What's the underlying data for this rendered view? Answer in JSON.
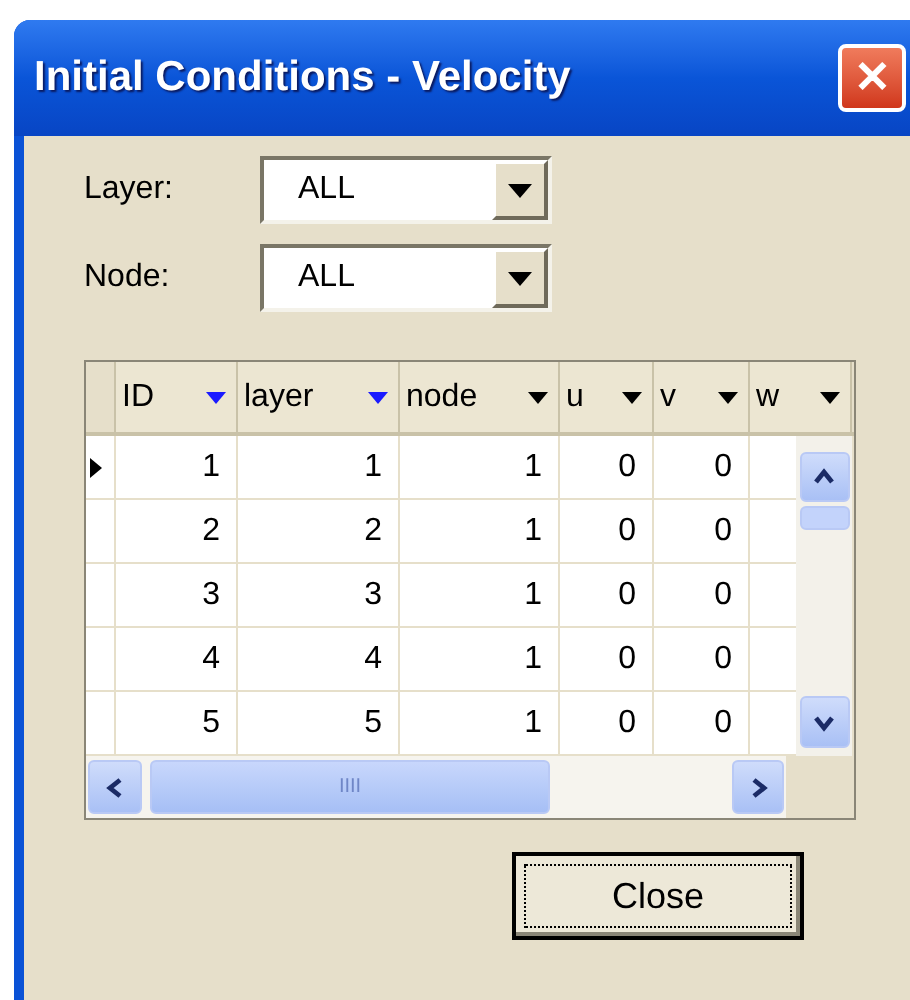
{
  "window": {
    "title": "Initial Conditions - Velocity",
    "close_glyph": "✕"
  },
  "filters": [
    {
      "label": "Layer:",
      "value": "ALL"
    },
    {
      "label": "Node:",
      "value": "ALL"
    }
  ],
  "table": {
    "columns": [
      {
        "label": "ID",
        "sorted": true
      },
      {
        "label": "layer",
        "sorted": true
      },
      {
        "label": "node",
        "sorted": false
      },
      {
        "label": "u",
        "sorted": false
      },
      {
        "label": "v",
        "sorted": false
      },
      {
        "label": "w",
        "sorted": false
      }
    ],
    "rows": [
      {
        "current": true,
        "cells": [
          "1",
          "1",
          "1",
          "0",
          "0"
        ]
      },
      {
        "current": false,
        "cells": [
          "2",
          "2",
          "1",
          "0",
          "0"
        ]
      },
      {
        "current": false,
        "cells": [
          "3",
          "3",
          "1",
          "0",
          "0"
        ]
      },
      {
        "current": false,
        "cells": [
          "4",
          "4",
          "1",
          "0",
          "0"
        ]
      },
      {
        "current": false,
        "cells": [
          "5",
          "5",
          "1",
          "0",
          "0"
        ]
      }
    ],
    "scroll_thumb_glyph": "IIII"
  },
  "buttons": [
    {
      "label": "Close"
    }
  ]
}
